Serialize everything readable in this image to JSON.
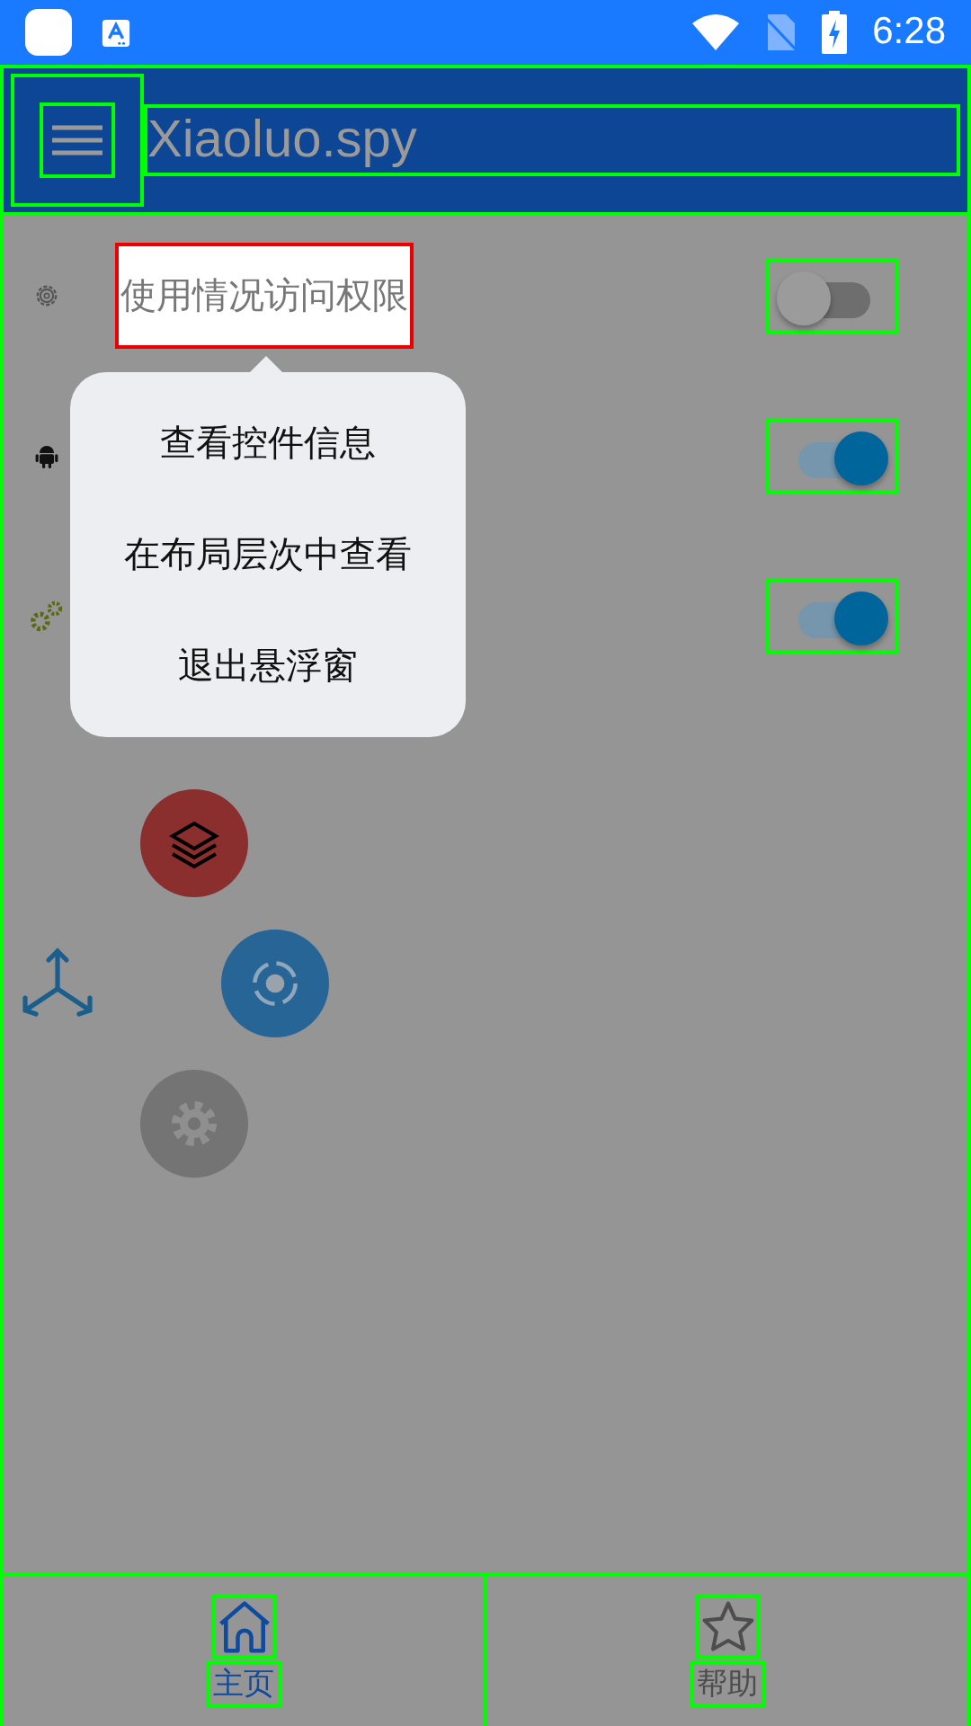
{
  "status_bar": {
    "time": "6:28"
  },
  "toolbar": {
    "title": "Xiaoluo.spy"
  },
  "settings": [
    {
      "kind": "gear",
      "label": "使用情况访问权限",
      "selected": true,
      "on": false
    },
    {
      "kind": "android",
      "on": true
    },
    {
      "kind": "gears",
      "on": true
    }
  ],
  "popup_menu": [
    "查看控件信息",
    "在布局层次中查看",
    "退出悬浮窗"
  ],
  "bottom_nav": [
    {
      "kind": "home",
      "label": "主页",
      "selected": true
    },
    {
      "kind": "star",
      "label": "帮助",
      "selected": false
    }
  ]
}
